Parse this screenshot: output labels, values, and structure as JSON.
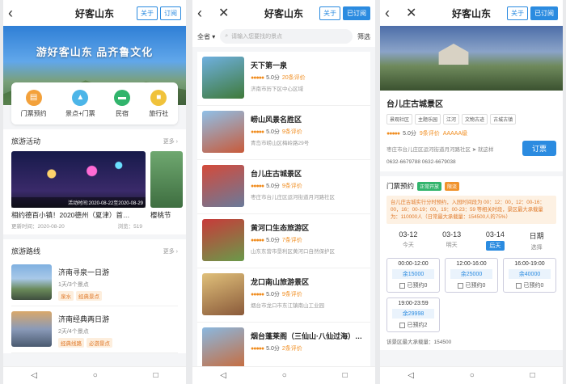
{
  "app": {
    "title": "好客山东",
    "about": "关于",
    "subscribe": "订阅",
    "subscribed": "已订阅"
  },
  "nav": {
    "back": "◁",
    "home": "○",
    "recent": "□"
  },
  "screen1": {
    "hero_slogan": "游好客山东  品齐鲁文化",
    "quick": [
      {
        "label": "门票预约",
        "color": "#f3a13b",
        "icon": "🎫"
      },
      {
        "label": "景点+门票",
        "color": "#4cb5e8",
        "icon": "⛰"
      },
      {
        "label": "民宿",
        "color": "#31b46c",
        "icon": "🛏"
      },
      {
        "label": "旅行社",
        "color": "#f0c23b",
        "icon": "💼"
      }
    ],
    "activity": {
      "title": "旅游活动",
      "more": "更多 ›",
      "card_time": "活动时间:2020-08-22至2020-08-29",
      "card_title": "相约德百小镇！2020德州（夏津）首…",
      "card_update": "更新时间：2020-08-20",
      "card_views": "浏览：519",
      "card2_title": "樱桃节"
    },
    "routes": {
      "title": "旅游路线",
      "more": "更多 ›",
      "items": [
        {
          "name": "济南寻泉一日游",
          "count": "1天/3个景点",
          "tags": [
            "泉水",
            "经典景点"
          ]
        },
        {
          "name": "济南经典两日游",
          "count": "2天/4个景点",
          "tags": [
            "经典线路",
            "必游景点"
          ]
        }
      ]
    }
  },
  "screen2": {
    "province": "全省 ▾",
    "search_placeholder": "请输入您要找的景点",
    "filter": "筛选",
    "spots": [
      {
        "name": "天下第一泉",
        "score": "5.0分",
        "reviews": "20条评价",
        "addr": "济南市历下区中心区域",
        "c1": "#6fb0e0",
        "c2": "#3f7a3a"
      },
      {
        "name": "崂山风景名胜区",
        "score": "5.0分",
        "reviews": "9条评价",
        "addr": "青岛市崂山区梅岭路29号",
        "c1": "#8fc0e8",
        "c2": "#c85a3a"
      },
      {
        "name": "台儿庄古城景区",
        "score": "5.0分",
        "reviews": "9条评价",
        "addr": "枣庄市台儿庄区运河街道月河路社区",
        "c1": "#d44a3a",
        "c2": "#6a7a9a"
      },
      {
        "name": "黄河口生态旅游区",
        "score": "5.0分",
        "reviews": "7条评价",
        "addr": "山东东营市垦利区黄河口自然保护区",
        "c1": "#c83a3a",
        "c2": "#6a9a4a"
      },
      {
        "name": "龙口南山旅游景区",
        "score": "5.0分",
        "reviews": "9条评价",
        "addr": "烟台市龙口市东江镇南山工业园",
        "c1": "#e0c07a",
        "c2": "#8a5a3a"
      },
      {
        "name": "烟台蓬莱阁（三仙山·八仙过海）…",
        "score": "5.0分",
        "reviews": "2条评价",
        "addr": "",
        "c1": "#8ab8e0",
        "c2": "#c86a3a"
      }
    ]
  },
  "screen3": {
    "name": "台儿庄古城景区",
    "chips": [
      "景观社区",
      "主题乐园",
      "江河",
      "文物古迹",
      "古城古镇"
    ],
    "score": "5.0分",
    "reviews": "9条评价",
    "level": "AAAAA级",
    "address": "枣庄市台儿庄区运河街道月河路社区 ➤ 就这样",
    "buy": "订票",
    "phones": "0632-6679788  0632-6679038",
    "ticket_label": "门票预约",
    "status_open": "正常开放",
    "status_limit": "限流",
    "notice": "台儿庄古城实行分时预约，入园时间段为 00：12：00，12：00-16：00，16：00-19：00，19：00-23：59 等相关时段，景区最大承载量为：110000人（日常最大承载量：154500人的75%）",
    "dates": [
      {
        "d": "03-12",
        "w": "今天"
      },
      {
        "d": "03-13",
        "w": "明天"
      },
      {
        "d": "03-14",
        "w": "后天"
      },
      {
        "d": "日期",
        "w": "选择"
      }
    ],
    "slots": [
      {
        "time": "00:00-12:00",
        "remain": "余15000",
        "booked": "已预约0"
      },
      {
        "time": "12:00-16:00",
        "remain": "余25000",
        "booked": "已预约0"
      },
      {
        "time": "16:00-19:00",
        "remain": "余40000",
        "booked": "已预约0"
      },
      {
        "time": "19:00-23:59",
        "remain": "余29998",
        "booked": "已预约2"
      }
    ],
    "capacity": "该景区最大承载量：154500"
  }
}
